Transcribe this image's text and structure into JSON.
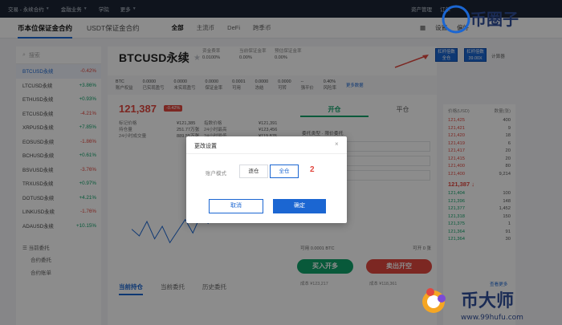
{
  "topnav": {
    "items": [
      "交易 - 永续合约",
      "金融业务",
      "学院",
      "更多"
    ],
    "right": [
      "资产管理",
      "订单"
    ]
  },
  "market_tabs": [
    "币本位保证金合约",
    "USDT保证金合约"
  ],
  "coin_tabs": [
    "全部",
    "主流币",
    "DeFi",
    "跨季币"
  ],
  "tools": [
    "设置",
    "偏好"
  ],
  "sidebar": {
    "search_placeholder": "搜索",
    "pairs": [
      {
        "name": "BTCUSD永续",
        "change": "-0.42%",
        "dir": "down"
      },
      {
        "name": "LTCUSD永续",
        "change": "+3.86%",
        "dir": "up"
      },
      {
        "name": "ETHUSD永续",
        "change": "+0.93%",
        "dir": "up"
      },
      {
        "name": "ETCUSD永续",
        "change": "-4.21%",
        "dir": "down"
      },
      {
        "name": "XRPUSD永续",
        "change": "+7.85%",
        "dir": "up"
      },
      {
        "name": "EOSUSD永续",
        "change": "-1.86%",
        "dir": "down"
      },
      {
        "name": "BCHUSD永续",
        "change": "+0.61%",
        "dir": "up"
      },
      {
        "name": "BSVUSD永续",
        "change": "-3.76%",
        "dir": "down"
      },
      {
        "name": "TRXUSD永续",
        "change": "+0.97%",
        "dir": "up"
      },
      {
        "name": "DOTUSD永续",
        "change": "+4.21%",
        "dir": "up"
      },
      {
        "name": "LINKUSD永续",
        "change": "-1.76%",
        "dir": "down"
      },
      {
        "name": "ADAUSD永续",
        "change": "+10.15%",
        "dir": "up"
      }
    ],
    "section": "当前委托",
    "sub": [
      "合约委托",
      "合约账单"
    ]
  },
  "header": {
    "symbol": "BTCUSD永续",
    "stats": [
      {
        "label": "资金费率",
        "value": "0.0100%"
      },
      {
        "label": "当前保证金率",
        "value": "0.00%"
      },
      {
        "label": "预估保证金率",
        "value": "0.00%"
      }
    ]
  },
  "statrow": [
    {
      "label": "账户权益",
      "value": "BTC"
    },
    {
      "label": "已实现盈亏",
      "value": "0.0000"
    },
    {
      "label": "未实现盈亏",
      "value": "0.0000"
    },
    {
      "label": "保证金率",
      "value": "0.0000"
    },
    {
      "label": "可用",
      "value": "0.0001"
    },
    {
      "label": "冻结",
      "value": "0.0000"
    },
    {
      "label": "可转",
      "value": "0.0000"
    },
    {
      "label": "强平价",
      "value": "--"
    },
    {
      "label": "风险率",
      "value": "0.40%"
    }
  ],
  "statrow_link": "更多数据",
  "price": {
    "last": "121,387",
    "change": "-0.42%"
  },
  "info": {
    "labels": [
      "标记价格",
      "持仓量",
      "24小时成交量"
    ],
    "values": [
      "¥121,385",
      "251.77万张",
      "889.55万张"
    ],
    "labels2": [
      "指数价格",
      "24小时最高",
      "24小时最低"
    ],
    "values2": [
      "¥121,391",
      "¥123,456",
      "¥119,876"
    ]
  },
  "order_tabs": [
    "开仓",
    "平仓"
  ],
  "order_type": "委托类型 · 限价委托",
  "fields": [
    "价格",
    "数量(张)",
    "可开张数"
  ],
  "avail": "可用 0.0001 BTC",
  "avail2": "可开 0 张",
  "buy_label": "买入开多",
  "sell_label": "卖出开空",
  "cost1": "成本 ¥123,217",
  "cost2": "成本 ¥118,361",
  "bottom_tabs": [
    "当前持仓",
    "当前委托",
    "历史委托"
  ],
  "leverage": [
    {
      "top": "杠杆倍数",
      "bot": "全仓"
    },
    {
      "top": "杠杆倍数",
      "bot": "39.00X"
    }
  ],
  "calc": "计算器",
  "book": {
    "hdr": [
      "价格(USD)",
      "数量(张)"
    ],
    "sells": [
      {
        "p": "121,425",
        "q": "400"
      },
      {
        "p": "121,421",
        "q": "9"
      },
      {
        "p": "121,420",
        "q": "18"
      },
      {
        "p": "121,419",
        "q": "6"
      },
      {
        "p": "121,417",
        "q": "20"
      },
      {
        "p": "121,415",
        "q": "20"
      },
      {
        "p": "121,400",
        "q": "80"
      },
      {
        "p": "121,400",
        "q": "9,214"
      }
    ],
    "last": "121,387",
    "buys": [
      {
        "p": "121,404",
        "q": "100"
      },
      {
        "p": "121,396",
        "q": "148"
      },
      {
        "p": "121,377",
        "q": "1,452"
      },
      {
        "p": "121,318",
        "q": "150"
      },
      {
        "p": "121,375",
        "q": "1"
      },
      {
        "p": "121,364",
        "q": "91"
      },
      {
        "p": "121,364",
        "q": "30"
      }
    ],
    "more": "查看更多"
  },
  "dialog": {
    "title": "更改设置",
    "close": "×",
    "mode_label": "账户模式",
    "options": [
      "逐仓",
      "全仓"
    ],
    "selected": "全仓",
    "marker": "2",
    "cancel": "取消",
    "ok": "确定"
  },
  "watermark": {
    "top": "币圈子",
    "bottom": "币大师",
    "url": "www.99hufu.com"
  },
  "chart_data": {
    "type": "line",
    "points": [
      0.52,
      0.45,
      0.6,
      0.42,
      0.55,
      0.38,
      0.5,
      0.62,
      0.48,
      0.66,
      0.58,
      0.72,
      0.6,
      0.78,
      0.66,
      0.74,
      0.7,
      0.82,
      0.76,
      0.86,
      0.8,
      0.9
    ]
  },
  "colors": {
    "accent": "#1b66d2",
    "up": "#10a36a",
    "down": "#e2473f"
  }
}
